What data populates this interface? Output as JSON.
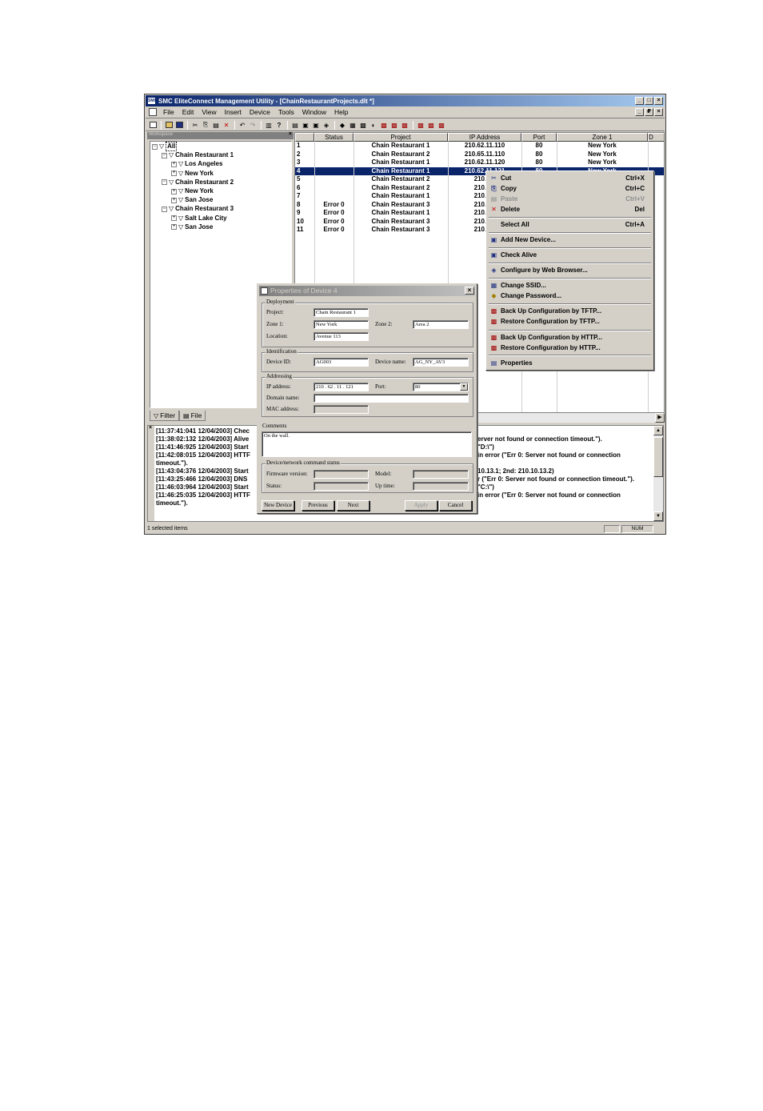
{
  "window": {
    "title": "SMC EliteConnect Management Utility - [ChainRestaurantProjects.dlt *]",
    "app_icon": "SMC",
    "min": "_",
    "max": "□",
    "close": "×",
    "restore": "₽"
  },
  "menubar": [
    "File",
    "Edit",
    "View",
    "Insert",
    "Device",
    "Tools",
    "Window",
    "Help"
  ],
  "workspace": {
    "header": "Workspace",
    "close": "×",
    "tree": [
      {
        "label": "All",
        "level": 0,
        "sign": "−"
      },
      {
        "label": "Chain Restaurant 1",
        "level": 1,
        "sign": "−"
      },
      {
        "label": "Los Angeles",
        "level": 2,
        "sign": "+"
      },
      {
        "label": "New York",
        "level": 2,
        "sign": "+"
      },
      {
        "label": "Chain Restaurant 2",
        "level": 1,
        "sign": "−"
      },
      {
        "label": "New York",
        "level": 2,
        "sign": "+"
      },
      {
        "label": "San Jose",
        "level": 2,
        "sign": "+"
      },
      {
        "label": "Chain Restaurant 3",
        "level": 1,
        "sign": "−"
      },
      {
        "label": "Salt Lake City",
        "level": 2,
        "sign": "+"
      },
      {
        "label": "San Jose",
        "level": 2,
        "sign": "+"
      }
    ],
    "tabs": [
      "Filter",
      "File"
    ]
  },
  "grid": {
    "columns": [
      "",
      "Status",
      "Project",
      "IP Address",
      "Port",
      "Zone 1",
      "D"
    ],
    "rows": [
      {
        "n": "1",
        "status": "",
        "project": "Chain Restaurant 1",
        "ip": "210.62.11.110",
        "port": "80",
        "zone": "New York"
      },
      {
        "n": "2",
        "status": "",
        "project": "Chain Restaurant 2",
        "ip": "210.65.11.110",
        "port": "80",
        "zone": "New York"
      },
      {
        "n": "3",
        "status": "",
        "project": "Chain Restaurant 1",
        "ip": "210.62.11.120",
        "port": "80",
        "zone": "New York"
      },
      {
        "n": "4",
        "status": "",
        "project": "Chain Restaurant 1",
        "ip": "210.62.11.121",
        "port": "80",
        "zone": "New York"
      },
      {
        "n": "5",
        "status": "",
        "project": "Chain Restaurant 2",
        "ip": "210.62.",
        "port": "",
        "zone": ""
      },
      {
        "n": "6",
        "status": "",
        "project": "Chain Restaurant 2",
        "ip": "210.62.",
        "port": "",
        "zone": ""
      },
      {
        "n": "7",
        "status": "",
        "project": "Chain Restaurant 1",
        "ip": "210.62.",
        "port": "",
        "zone": ""
      },
      {
        "n": "8",
        "status": "Error 0",
        "project": "Chain Restaurant 3",
        "ip": "210.63.",
        "port": "",
        "zone": ""
      },
      {
        "n": "9",
        "status": "Error 0",
        "project": "Chain Restaurant 1",
        "ip": "210.62.",
        "port": "",
        "zone": ""
      },
      {
        "n": "10",
        "status": "Error 0",
        "project": "Chain Restaurant 3",
        "ip": "210.62.",
        "port": "",
        "zone": ""
      },
      {
        "n": "11",
        "status": "Error 0",
        "project": "Chain Restaurant 3",
        "ip": "210.62.",
        "port": "",
        "zone": ""
      }
    ]
  },
  "log": {
    "lines": [
      "[11:37:41:041 12/04/2003]  Chec",
      "[11:38:02:132 12/04/2003]  Alive",
      "[11:41:46:925 12/04/2003]  Start",
      "[11:42:08:015 12/04/2003]  HTTF",
      "timeout.\").",
      "[11:43:04:376 12/04/2003]  Start",
      "[11:43:25:466 12/04/2003]  DNS",
      "[11:46:03:964 12/04/2003]  Start",
      "[11:46:25:035 12/04/2003]  HTTF",
      "timeout.\")."
    ],
    "right_lines": [
      "erver not found or connection timeout.\").",
      "\"D:\\\")",
      "in error (\"Err 0: Server not found or connection",
      "10.13.1; 2nd: 210.10.13.2)",
      "r (\"Err 0: Server not found or connection timeout.\").",
      "\"C:\\\")",
      "in error (\"Err 0: Server not found or connection"
    ],
    "close": "×"
  },
  "statusbar": {
    "text": "1 selected items",
    "num": "NUM"
  },
  "context_menu": {
    "items": [
      {
        "icon": "✂",
        "label": "Cut",
        "shortcut": "Ctrl+X",
        "disabled": false
      },
      {
        "icon": "⎘",
        "label": "Copy",
        "shortcut": "Ctrl+C",
        "disabled": false
      },
      {
        "icon": "▤",
        "label": "Paste",
        "shortcut": "Ctrl+V",
        "disabled": true
      },
      {
        "icon": "✕",
        "label": "Delete",
        "shortcut": "Del",
        "disabled": false
      },
      {
        "icon": "",
        "label": "Select All",
        "shortcut": "Ctrl+A",
        "disabled": false
      },
      {
        "icon": "▣",
        "label": "Add New Device...",
        "shortcut": "",
        "disabled": false
      },
      {
        "icon": "▣",
        "label": "Check Alive",
        "shortcut": "",
        "disabled": false
      },
      {
        "icon": "◈",
        "label": "Configure by Web Browser...",
        "shortcut": "",
        "disabled": false
      },
      {
        "icon": "▦",
        "label": "Change SSID...",
        "shortcut": "",
        "disabled": false
      },
      {
        "icon": "◆",
        "label": "Change Password...",
        "shortcut": "",
        "disabled": false
      },
      {
        "icon": "▩",
        "label": "Back Up Configuration by TFTP...",
        "shortcut": "",
        "disabled": false
      },
      {
        "icon": "▩",
        "label": "Restore Configuration by TFTP...",
        "shortcut": "",
        "disabled": false
      },
      {
        "icon": "▩",
        "label": "Back Up Configuration by HTTP...",
        "shortcut": "",
        "disabled": false
      },
      {
        "icon": "▩",
        "label": "Restore Configuration by HTTP...",
        "shortcut": "",
        "disabled": false
      },
      {
        "icon": "▤",
        "label": "Properties",
        "shortcut": "",
        "disabled": false
      }
    ]
  },
  "dialog": {
    "title": "Properties of Device 4",
    "close": "×",
    "deployment": {
      "legend": "Deployment",
      "project_label": "Project:",
      "project": "Chain Restaurant 1",
      "zone1_label": "Zone 1:",
      "zone1": "New York",
      "zone2_label": "Zone 2:",
      "zone2": "Area 2",
      "location_label": "Location:",
      "location": "Avenue 113"
    },
    "identification": {
      "legend": "Identification",
      "device_id_label": "Device ID:",
      "device_id": "AG003",
      "device_name_label": "Device name:",
      "device_name": "AG_NY_AV3"
    },
    "addressing": {
      "legend": "Addressing",
      "ip_label": "IP address:",
      "ip": "210 . 62 . 11 . 121",
      "port_label": "Port:",
      "port": "80",
      "domain_label": "Domain name:",
      "domain": "",
      "mac_label": "MAC address:",
      "mac": ""
    },
    "comments": {
      "legend": "Comments",
      "text": "On the wall."
    },
    "status": {
      "legend": "Device/network command status",
      "firmware_label": "Firmware version:",
      "model_label": "Model:",
      "status_label": "Status:",
      "uptime_label": "Up time:"
    },
    "buttons": {
      "new_device": "New Device",
      "previous": "Previous",
      "next": "Next",
      "apply": "Apply",
      "cancel": "Cancel"
    }
  }
}
